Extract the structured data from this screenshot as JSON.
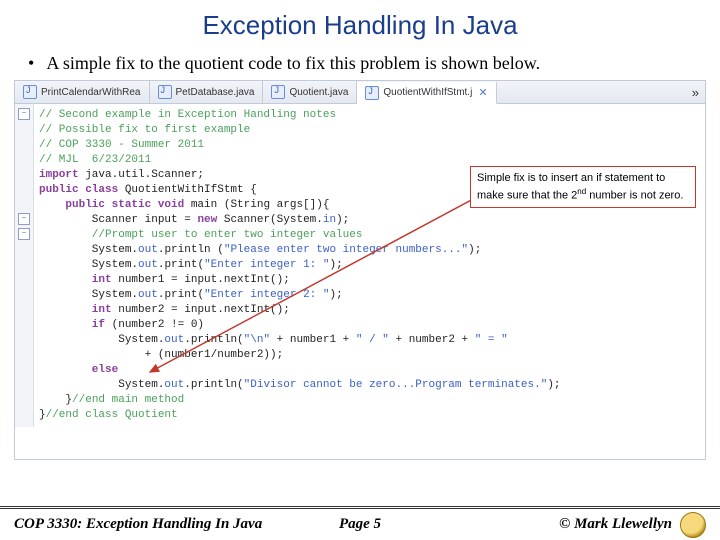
{
  "title": "Exception Handling In Java",
  "bullet": "A simple fix to the quotient code to fix this problem is shown below.",
  "tabs": {
    "t0": "PrintCalendarWithRea",
    "t1": "PetDatabase.java",
    "t2": "Quotient.java",
    "t3": "QuotientWithIfStmt.j",
    "overflow": "»"
  },
  "code": {
    "l01": "// Second example in Exception Handling notes",
    "l02": "// Possible fix to first example",
    "l03": "// COP 3330 - Summer 2011",
    "l04": "// MJL  6/23/2011",
    "l05": "",
    "l06a": "import",
    "l06b": " java.util.Scanner;",
    "l07": "",
    "l08a": "public class",
    "l08b": " QuotientWithIfStmt {",
    "l09a": "    public static void",
    "l09b": " main (String args[]){",
    "l10a": "        Scanner input = ",
    "l10b": "new",
    "l10c": " Scanner(System.",
    "l10d": "in",
    "l10e": ");",
    "l11": "        //Prompt user to enter two integer values",
    "l12a": "        System.",
    "l12o": "out",
    "l12b": ".println (",
    "l12c": "\"Please enter two integer numbers...\"",
    "l12d": ");",
    "l13a": "        System.",
    "l13o": "out",
    "l13b": ".print(",
    "l13c": "\"Enter integer 1: \"",
    "l13d": ");",
    "l14a": "        int",
    "l14b": " number1 = input.nextInt();",
    "l15a": "        System.",
    "l15o": "out",
    "l15b": ".print(",
    "l15c": "\"Enter integer 2: \"",
    "l15d": ");",
    "l16a": "        int",
    "l16b": " number2 = input.nextInt();",
    "l17a": "        if",
    "l17b": " (number2 != 0)",
    "l18a": "            System.",
    "l18o": "out",
    "l18b": ".println(",
    "l18c": "\"\\n\"",
    "l18d": " + number1 + ",
    "l18e": "\" / \"",
    "l18f": " + number2 + ",
    "l18g": "\" = \"",
    "l19a": "                + (number1/number2));",
    "l20a": "        else",
    "l21a": "            System.",
    "l21o": "out",
    "l21b": ".println(",
    "l21c": "\"Divisor cannot be zero...Program terminates.\"",
    "l21d": ");",
    "l22a": "    }",
    "l22b": "//end main method",
    "l23a": "}",
    "l23b": "//end class Quotient"
  },
  "callout": {
    "text_a": "Simple fix is to insert an if statement to make sure that the 2",
    "sup": "nd",
    "text_b": " number is not zero."
  },
  "footer": {
    "left": "COP 3330:  Exception Handling In Java",
    "center": "Page 5",
    "right": "© Mark Llewellyn"
  }
}
